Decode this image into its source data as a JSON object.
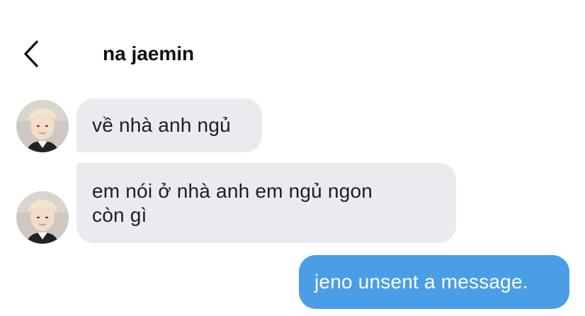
{
  "header": {
    "title": "na jaemin",
    "back_icon": "chevron-left-icon"
  },
  "messages": [
    {
      "sender": "incoming",
      "text": "về nhà anh ngủ"
    },
    {
      "sender": "incoming",
      "text": "em nói ở nhà anh em ngủ ngon\ncòn gì"
    },
    {
      "sender": "outgoing",
      "text": "jeno unsent a message."
    }
  ],
  "colors": {
    "incoming_bubble": "#e9ebef",
    "outgoing_bubble": "#4a9ee6",
    "background": "#ffffff"
  }
}
